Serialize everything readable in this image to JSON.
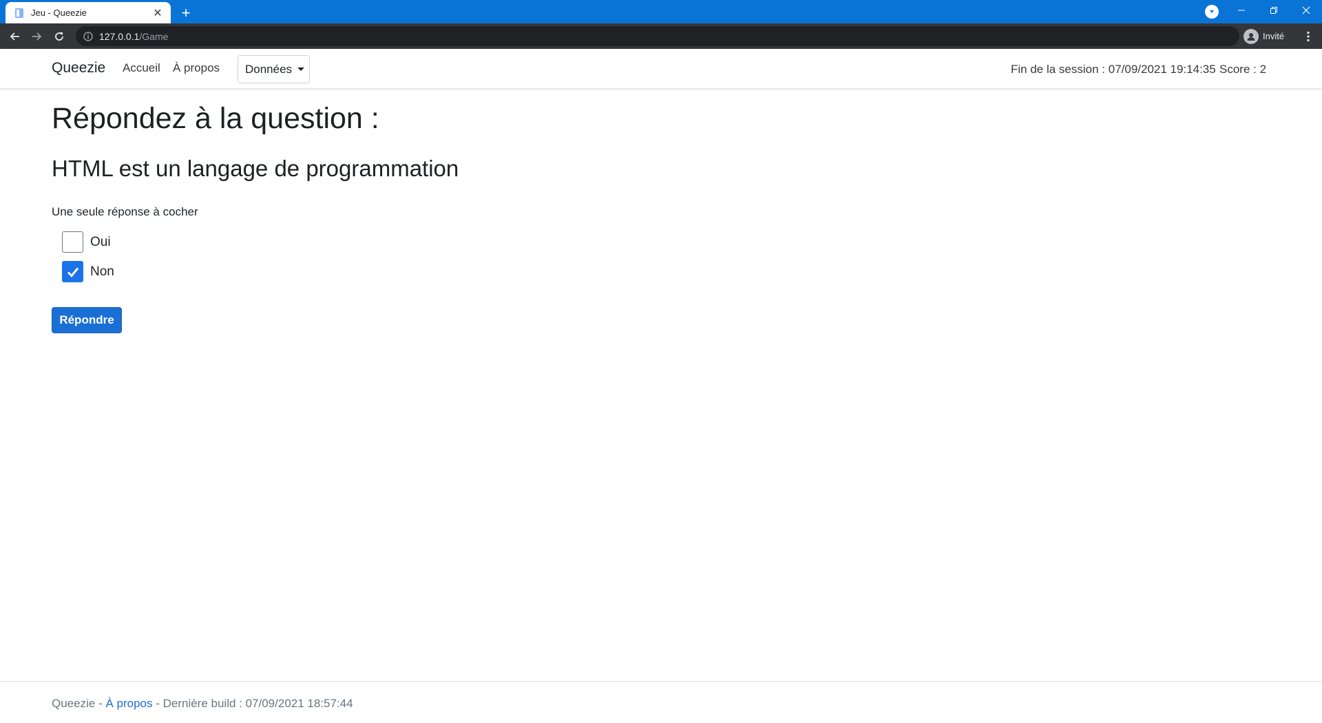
{
  "browser": {
    "tab_title": "Jeu - Queezie",
    "url_host": "127.0.0.1",
    "url_path": "/Game",
    "profile_label": "Invité"
  },
  "navbar": {
    "brand": "Queezie",
    "links": [
      "Accueil",
      "À propos"
    ],
    "dropdown_label": "Données",
    "session_end": "Fin de la session : 07/09/2021 19:14:35",
    "score": "Score : 2"
  },
  "main": {
    "title": "Répondez à la question :",
    "question": "HTML est un langage de programmation",
    "hint": "Une seule réponse à cocher",
    "options": [
      {
        "label": "Oui",
        "checked": false
      },
      {
        "label": "Non",
        "checked": true
      }
    ],
    "submit_label": "Répondre"
  },
  "footer": {
    "brand": "Queezie",
    "sep1": " - ",
    "link": "À propos",
    "sep2": " - ",
    "build": "Dernière build : 07/09/2021 18:57:44"
  },
  "colors": {
    "tabbar": "#0a74d6",
    "toolbar": "#35363a",
    "primary": "#1a6fd4",
    "checkbox_checked": "#1a73e8"
  }
}
